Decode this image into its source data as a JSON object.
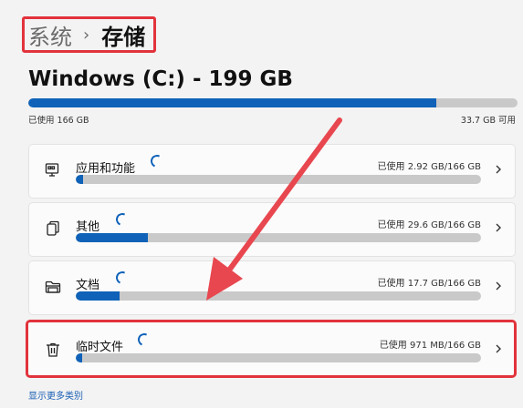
{
  "breadcrumb": {
    "parent": "系统",
    "separator": "›",
    "current": "存储"
  },
  "drive": {
    "title": "Windows (C:) - 199 GB",
    "used_label": "已使用 166 GB",
    "free_label": "33.7 GB 可用",
    "used_fraction": 0.834
  },
  "categories": [
    {
      "label": "应用和功能",
      "usage": "已使用 2.92 GB/166 GB",
      "fraction": 0.018,
      "icon": "app-features-icon"
    },
    {
      "label": "其他",
      "usage": "已使用 29.6 GB/166 GB",
      "fraction": 0.178,
      "icon": "other-files-icon"
    },
    {
      "label": "文档",
      "usage": "已使用 17.7 GB/166 GB",
      "fraction": 0.107,
      "icon": "folder-icon"
    },
    {
      "label": "临时文件",
      "usage": "已使用 971 MB/166 GB",
      "fraction": 0.006,
      "icon": "trash-icon"
    }
  ],
  "show_more": "显示更多类别",
  "colors": {
    "accent": "#0f62b8",
    "highlight": "#e2333c",
    "bar_track": "#c9c9c9"
  }
}
